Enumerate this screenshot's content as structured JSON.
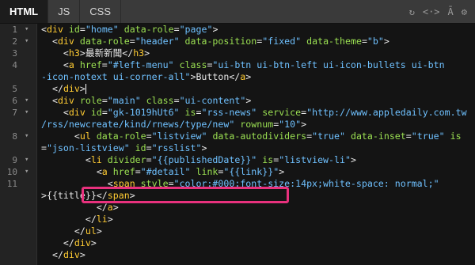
{
  "tabs": [
    {
      "label": "HTML",
      "active": true
    },
    {
      "label": "JS",
      "active": false
    },
    {
      "label": "CSS",
      "active": false
    }
  ],
  "toolbar": {
    "icons": [
      "refresh-icon",
      "code-icon",
      "font-size-icon",
      "settings-icon"
    ],
    "glyphs": [
      "↻",
      "<·>",
      "Ā",
      "⚙"
    ]
  },
  "gutter": {
    "line_numbers": [
      "1",
      "2",
      "3",
      "4",
      "",
      "5",
      "6",
      "7",
      "",
      "8",
      "",
      "9",
      "10",
      "11",
      "",
      "",
      "",
      "",
      "",
      ""
    ]
  },
  "code": {
    "l1": [
      "<",
      "div",
      " ",
      "id",
      "=",
      "\"home\"",
      " ",
      "data-role",
      "=",
      "\"page\"",
      ">"
    ],
    "l2": [
      "<",
      "div",
      " ",
      "data-role",
      "=",
      "\"header\"",
      " ",
      "data-position",
      "=",
      "\"fixed\"",
      " ",
      "data-theme",
      "=",
      "\"b\"",
      ">"
    ],
    "l3": [
      "<",
      "h3",
      ">最新新聞</",
      "h3",
      ">"
    ],
    "l4": [
      "<",
      "a",
      " ",
      "href",
      "=",
      "\"#left-menu\"",
      " ",
      "class",
      "=",
      "\"ui-btn ui-btn-left ui-icon-bullets ui-btn"
    ],
    "l4b": [
      "-icon-notext ui-corner-all\"",
      ">Button</",
      "a",
      ">"
    ],
    "l5": [
      "</",
      "div",
      ">"
    ],
    "l6": [
      "<",
      "div",
      " ",
      "role",
      "=",
      "\"main\"",
      " ",
      "class",
      "=",
      "\"ui-content\"",
      ">"
    ],
    "l7": [
      "<",
      "div",
      " ",
      "id",
      "=",
      "\"gk-1019hUt6\"",
      " ",
      "is",
      "=",
      "\"rss-news\"",
      " ",
      "service",
      "=",
      "\"http://www.appledaily.com.tw"
    ],
    "l7b": [
      "/rss/newcreate/kind/rnews/type/new\"",
      " ",
      "rownum",
      "=",
      "\"10\"",
      ">"
    ],
    "l8": [
      "<",
      "ul",
      " ",
      "data-role",
      "=",
      "\"listview\"",
      " ",
      "data-autodividers",
      "=",
      "\"true\"",
      " ",
      "data-inset",
      "=",
      "\"true\"",
      " ",
      "is"
    ],
    "l8b": [
      "=",
      "\"json-listview\"",
      " ",
      "id",
      "=",
      "\"rsslist\"",
      ">"
    ],
    "l9": [
      "<",
      "li",
      " ",
      "divider",
      "=",
      "\"{{publishedDate}}\"",
      " ",
      "is",
      "=",
      "\"listview-li\"",
      ">"
    ],
    "l10": [
      "<",
      "a",
      " ",
      "href",
      "=",
      "\"#detail\"",
      " ",
      "link",
      "=",
      "\"{{link}}\"",
      ">"
    ],
    "l11": [
      "<",
      "span",
      " ",
      "style",
      "=",
      "\"color:#000;font-size:14px;white-space: normal;\""
    ],
    "l11b": [
      ">{{title}}</",
      "span",
      ">"
    ],
    "l12": [
      "</",
      "a",
      ">"
    ],
    "l13": [
      "</",
      "li",
      ">"
    ],
    "l14": [
      "</",
      "ul",
      ">"
    ],
    "l15": [
      "</",
      "div",
      ">"
    ],
    "l16": [
      "</",
      "div",
      ">"
    ]
  },
  "colors": {
    "tag": "#ffcc33",
    "attr": "#9be052",
    "string": "#6fc1ff",
    "highlight_border": "#e8317d"
  }
}
